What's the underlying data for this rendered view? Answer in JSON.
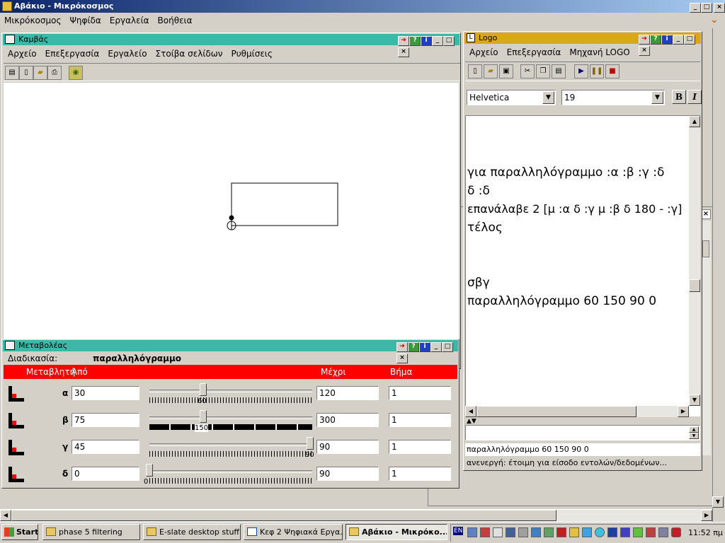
{
  "app": {
    "title": "Αβάκιο - Μικρόκοσμος",
    "menu": [
      "Μικρόκοσμος",
      "Ψηφίδα",
      "Εργαλεία",
      "Βοήθεια"
    ]
  },
  "canvas_window": {
    "title": "Καμβάς",
    "menu": [
      "Αρχείο",
      "Επεξεργασία",
      "Εργαλείο",
      "Στοίβα σελίδων",
      "Ρυθμίσεις"
    ]
  },
  "variator_window": {
    "title": "Μεταβολέας",
    "procedure_label": "Διαδικασία:",
    "procedure_name": "παραλληλόγραμμο",
    "headers": {
      "variable": "Μεταβλητή",
      "from": "Από",
      "to": "Μέχρι",
      "step": "Βήμα"
    },
    "rows": [
      {
        "name": "α",
        "from": "30",
        "to": "120",
        "step": "1",
        "value": "60",
        "fraction": 0.333
      },
      {
        "name": "β",
        "from": "75",
        "to": "300",
        "step": "1",
        "value": "150",
        "fraction": 0.333
      },
      {
        "name": "γ",
        "from": "45",
        "to": "90",
        "step": "1",
        "value": "90",
        "fraction": 1.0
      },
      {
        "name": "δ",
        "from": "0",
        "to": "90",
        "step": "1",
        "value": "0",
        "fraction": 0.0
      }
    ]
  },
  "logo_window": {
    "title": "Logo",
    "menu": [
      "Αρχείο",
      "Επεξεργασία",
      "Μηχανή LOGO"
    ],
    "font_name": "Helvetica",
    "font_size": "19",
    "bold_label": "B",
    "italic_label": "I",
    "code_lines": [
      "για παραλληλόγραμμο :α :β :γ :δ",
      "δ :δ",
      "επανάλαβε 2 [μ :α δ :γ μ :β δ 180 - :γ]",
      "τέλος",
      "σβγ",
      "παραλληλόγραμμο 60 150 90 0"
    ],
    "last_command": "παραλληλόγραμμο 60 150 90 0",
    "status": "ανενεργή: έτοιμη για είσοδο εντολών/δεδομένων..."
  },
  "taskbar": {
    "start": "Start",
    "tasks": [
      "phase 5 filtering",
      "E-slate desktop stuff",
      "Κεφ 2 Ψηφιακά Εργα...",
      "Αβάκιο - Μικρόκο..."
    ],
    "lang": "EN",
    "clock": "11:52 πμ"
  }
}
